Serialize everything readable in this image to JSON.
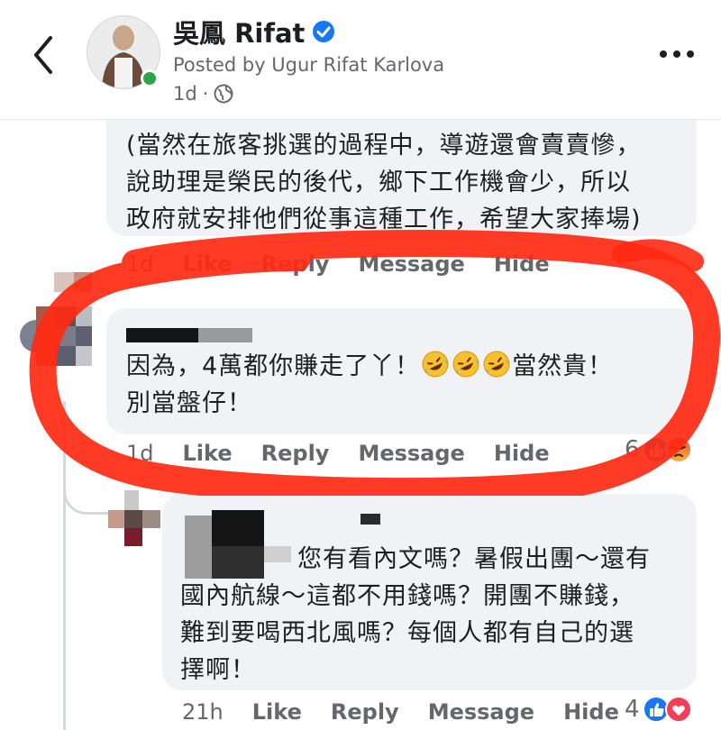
{
  "header": {
    "page_name": "吳鳳 Rifat",
    "posted_by": "Posted by Ugur Rifat Karlova",
    "age": "1d",
    "separator": "·"
  },
  "icons": {
    "back": "back-chevron-icon",
    "verified": "verified-badge-icon",
    "globe": "globe-icon",
    "more": "more-dots-icon",
    "emoji": "rolling-on-floor-laughing-emoji",
    "like_reaction": "like-reaction-icon",
    "angry_reaction": "angry-reaction-icon",
    "love_reaction": "love-reaction-icon"
  },
  "colors": {
    "facebook_blue": "#1877f2",
    "marker_red": "#ff2a12",
    "online_green": "#31a24c",
    "bubble_bg": "#f0f2f5"
  },
  "comments": [
    {
      "lines": [
        "(當然在旅客挑選的過程中，導遊還會賣賣慘，",
        "說助理是榮民的後代，鄉下工作機會少，所以",
        "政府就安排他們從事這種工作，希望大家捧場)"
      ],
      "time": "1d",
      "like": "Like",
      "reply": "Reply",
      "message": "Message",
      "hide": "Hide"
    },
    {
      "line1_before": "因為，4萬都你賺走了丫！",
      "line1_after": "當然貴！",
      "line2": "別當盤仔！",
      "time": "1d",
      "like": "Like",
      "reply": "Reply",
      "message": "Message",
      "hide": "Hide",
      "reaction_count": "6"
    },
    {
      "lines": [
        "您有看內文嗎？暑假出團～還有",
        "國內航線～這都不用錢嗎？開團不賺錢，",
        "難到要喝西北風嗎？每個人都有自己的選",
        "擇啊！"
      ],
      "time": "21h",
      "like": "Like",
      "reply": "Reply",
      "message": "Message",
      "hide": "Hide",
      "reaction_count": "4"
    }
  ]
}
